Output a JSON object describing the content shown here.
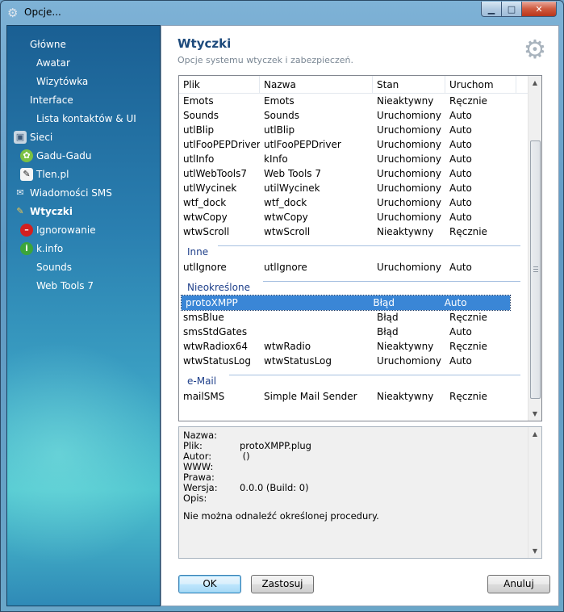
{
  "window": {
    "title": "Opcje..."
  },
  "sidebar": {
    "items": [
      {
        "label": "Główne",
        "icon": "none",
        "level": 1
      },
      {
        "label": "Awatar",
        "icon": "none",
        "level": 2
      },
      {
        "label": "Wizytówka",
        "icon": "none",
        "level": 2
      },
      {
        "label": "Interface",
        "icon": "none",
        "level": 1
      },
      {
        "label": "Lista kontaktów & UI",
        "icon": "none",
        "level": 2
      },
      {
        "label": "Sieci",
        "icon": "network-icon",
        "level": 1
      },
      {
        "label": "Gadu-Gadu",
        "icon": "gadu-gadu-icon",
        "level": 2
      },
      {
        "label": "Tlen.pl",
        "icon": "tlen-icon",
        "level": 2
      },
      {
        "label": "Wiadomości SMS",
        "icon": "sms-icon",
        "level": 1
      },
      {
        "label": "Wtyczki",
        "icon": "plugin-icon",
        "level": 1,
        "active": true
      },
      {
        "label": "Ignorowanie",
        "icon": "ignore-icon",
        "level": 2
      },
      {
        "label": "k.info",
        "icon": "info-icon",
        "level": 2
      },
      {
        "label": "Sounds",
        "icon": "none",
        "level": 2
      },
      {
        "label": "Web Tools 7",
        "icon": "none",
        "level": 2
      }
    ]
  },
  "main": {
    "title": "Wtyczki",
    "subtitle": "Opcje systemu wtyczek i zabezpieczeń.",
    "columns": [
      "Plik",
      "Nazwa",
      "Stan",
      "Uruchom"
    ],
    "groups": [
      {
        "label": "",
        "rows": [
          [
            "Emots",
            "Emots",
            "Nieaktywny",
            "Ręcznie"
          ],
          [
            "Sounds",
            "Sounds",
            "Uruchomiony",
            "Auto"
          ],
          [
            "utlBlip",
            "utlBlip",
            "Uruchomiony",
            "Auto"
          ],
          [
            "utlFooPEPDriver",
            "utlFooPEPDriver",
            "Uruchomiony",
            "Auto"
          ],
          [
            "utlInfo",
            "kInfo",
            "Uruchomiony",
            "Auto"
          ],
          [
            "utlWebTools7",
            "Web Tools 7",
            "Uruchomiony",
            "Auto"
          ],
          [
            "utlWycinek",
            "utilWycinek",
            "Uruchomiony",
            "Auto"
          ],
          [
            "wtf_dock",
            "wtf_dock",
            "Uruchomiony",
            "Auto"
          ],
          [
            "wtwCopy",
            "wtwCopy",
            "Uruchomiony",
            "Auto"
          ],
          [
            "wtwScroll",
            "wtwScroll",
            "Nieaktywny",
            "Ręcznie"
          ]
        ]
      },
      {
        "label": "Inne",
        "rows": [
          [
            "utlIgnore",
            "utlIgnore",
            "Uruchomiony",
            "Auto"
          ]
        ]
      },
      {
        "label": "Nieokreślone",
        "rows": [
          [
            "protoXMPP",
            "",
            "Błąd",
            "Auto"
          ],
          [
            "smsBlue",
            "",
            "Błąd",
            "Ręcznie"
          ],
          [
            "smsStdGates",
            "",
            "Błąd",
            "Auto"
          ],
          [
            "wtwRadiox64",
            "wtwRadio",
            "Nieaktywny",
            "Ręcznie"
          ],
          [
            "wtwStatusLog",
            "wtwStatusLog",
            "Uruchomiony",
            "Auto"
          ]
        ]
      },
      {
        "label": "e-Mail",
        "rows": [
          [
            "mailSMS",
            "Simple Mail Sender",
            "Nieaktywny",
            "Ręcznie"
          ]
        ]
      }
    ],
    "selected_row": "protoXMPP"
  },
  "details": {
    "fields": [
      {
        "label": "Nazwa:",
        "value": ""
      },
      {
        "label": "Plik:",
        "value": "protoXMPP.plug"
      },
      {
        "label": "Autor:",
        "value": " ()"
      },
      {
        "label": "WWW:",
        "value": ""
      },
      {
        "label": "Prawa:",
        "value": ""
      },
      {
        "label": "Wersja:",
        "value": "0.0.0 (Build: 0)"
      },
      {
        "label": "Opis:",
        "value": ""
      }
    ],
    "message": "Nie można odnaleźć określonej procedury."
  },
  "buttons": {
    "ok": "OK",
    "apply": "Zastosuj",
    "cancel": "Anuluj"
  }
}
